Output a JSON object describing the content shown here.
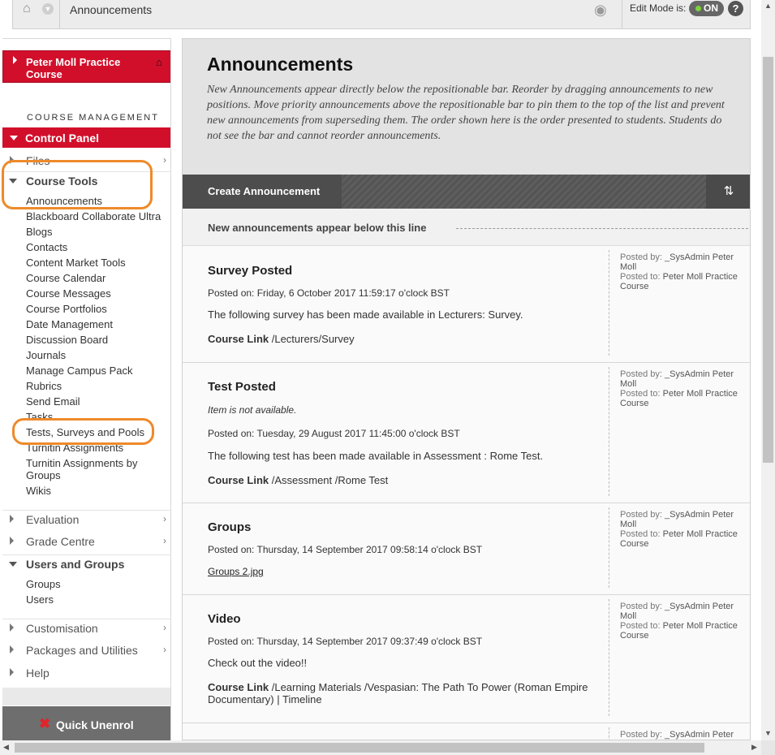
{
  "topbar": {
    "breadcrumb": "Announcements",
    "edit_mode_label": "Edit Mode is:",
    "edit_mode_value": "ON",
    "help_glyph": "?"
  },
  "nav": {
    "course_title": "Peter Moll Practice Course",
    "course_management_heading": "COURSE MANAGEMENT",
    "control_panel_label": "Control Panel",
    "files_label": "Files",
    "course_tools_label": "Course Tools",
    "course_tools_items": [
      "Announcements",
      "Blackboard Collaborate Ultra",
      "Blogs",
      "Contacts",
      "Content Market Tools",
      "Course Calendar",
      "Course Messages",
      "Course Portfolios",
      "Date Management",
      "Discussion Board",
      "Journals",
      "Manage Campus Pack",
      "Rubrics",
      "Send Email",
      "Tasks",
      "Tests, Surveys and Pools",
      "Turnitin Assignments",
      "Turnitin Assignments by Groups",
      "Wikis"
    ],
    "evaluation_label": "Evaluation",
    "grade_centre_label": "Grade Centre",
    "users_groups_label": "Users and Groups",
    "users_groups_items": [
      "Groups",
      "Users"
    ],
    "customisation_label": "Customisation",
    "packages_label": "Packages and Utilities",
    "help_label": "Help",
    "quick_unenrol_label": "Quick Unenrol"
  },
  "main": {
    "title": "Announcements",
    "description": "New Announcements appear directly below the repositionable bar. Reorder by dragging announcements to new positions. Move priority announcements above the repositionable bar to pin them to the top of the list and prevent new announcements from superseding them. The order shown here is the order presented to students. Students do not see the bar and cannot reorder announcements.",
    "create_button": "Create Announcement",
    "sort_glyph": "⇅",
    "new_line_label": "New announcements appear below this line",
    "posted_by_key": "Posted by:",
    "posted_to_key": "Posted to:",
    "announcements": [
      {
        "title": "Survey Posted",
        "posted_on": "Posted on: Friday, 6 October 2017 11:59:17 o'clock BST",
        "body": "The following survey has been made available in Lecturers: Survey.",
        "link_label": "Course Link",
        "link_path": " /Lecturers/Survey",
        "posted_by": "_SysAdmin Peter Moll",
        "posted_to": "Peter Moll Practice Course"
      },
      {
        "title": "Test Posted",
        "availability": "Item is not available.",
        "posted_on": "Posted on: Tuesday, 29 August 2017 11:45:00 o'clock BST",
        "body": "The following test has been made available in Assessment : Rome Test.",
        "link_label": "Course Link",
        "link_path": " /Assessment /Rome Test",
        "posted_by": "_SysAdmin Peter Moll",
        "posted_to": "Peter Moll Practice Course"
      },
      {
        "title": "Groups",
        "posted_on": "Posted on: Thursday, 14 September 2017 09:58:14 o'clock BST",
        "file": "Groups 2.jpg",
        "posted_by": "_SysAdmin Peter Moll",
        "posted_to": "Peter Moll Practice Course"
      },
      {
        "title": "Video",
        "posted_on": "Posted on: Thursday, 14 September 2017 09:37:49 o'clock BST",
        "body": "Check out the video!!",
        "link_label": "Course Link",
        "link_path": " /Learning Materials /Vespasian: The Path To Power (Roman Empire Documentary) | Timeline",
        "posted_by": "_SysAdmin Peter Moll",
        "posted_to": "Peter Moll Practice Course"
      },
      {
        "posted_by": "_SysAdmin Peter"
      }
    ]
  },
  "colors": {
    "brand_red": "#d20f2b",
    "highlight_orange": "#ee8a2a",
    "toggle_on_green": "#7cd33a"
  }
}
